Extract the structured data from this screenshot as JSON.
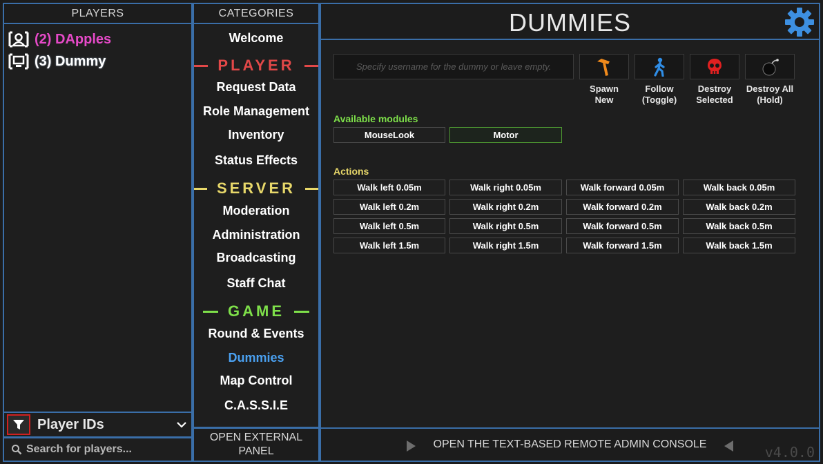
{
  "players": {
    "header": "PLAYERS",
    "items": [
      {
        "label": "(2) DApples",
        "color": "#e64ac8",
        "icon": "user-icon"
      },
      {
        "label": "(3) Dummy",
        "color": "#ffffff",
        "icon": "dummy-computer-icon"
      }
    ],
    "filter_label": "Player IDs",
    "search_placeholder": "Search for players..."
  },
  "categories": {
    "header": "CATEGORIES",
    "welcome": "Welcome",
    "sections": [
      {
        "title": "PLAYER",
        "color": "#e24848",
        "items": [
          "Request Data",
          "Role Management",
          "Inventory",
          "Status Effects"
        ]
      },
      {
        "title": "SERVER",
        "color": "#e8d86a",
        "items": [
          "Moderation",
          "Administration",
          "Broadcasting",
          "Staff Chat"
        ]
      },
      {
        "title": "GAME",
        "color": "#7ee04a",
        "items": [
          "Round & Events",
          "Dummies",
          "Map Control",
          "C.A.S.S.I.E"
        ]
      }
    ],
    "active_item": "Dummies",
    "active_color": "#4aa0f0",
    "external_panel": [
      "OPEN EXTERNAL",
      "PANEL"
    ]
  },
  "main": {
    "title": "DUMMIES",
    "username_placeholder": "Specify username for the dummy or leave empty.",
    "tools": [
      {
        "label": [
          "Spawn",
          "New"
        ],
        "icon": "hammer-icon"
      },
      {
        "label": [
          "Follow",
          "(Toggle)"
        ],
        "icon": "walking-person-icon"
      },
      {
        "label": [
          "Destroy",
          "Selected"
        ],
        "icon": "skull-icon"
      },
      {
        "label": [
          "Destroy All",
          "(Hold)"
        ],
        "icon": "bomb-icon"
      }
    ],
    "modules_label": "Available modules",
    "modules": [
      {
        "label": "MouseLook",
        "active": false
      },
      {
        "label": "Motor",
        "active": true
      }
    ],
    "actions_label": "Actions",
    "actions": [
      [
        "Walk left 0.05m",
        "Walk right 0.05m",
        "Walk forward 0.05m",
        "Walk back 0.05m"
      ],
      [
        "Walk left 0.2m",
        "Walk right 0.2m",
        "Walk forward 0.2m",
        "Walk back 0.2m"
      ],
      [
        "Walk left 0.5m",
        "Walk right 0.5m",
        "Walk forward 0.5m",
        "Walk back 0.5m"
      ],
      [
        "Walk left 1.5m",
        "Walk right 1.5m",
        "Walk forward 1.5m",
        "Walk back 1.5m"
      ]
    ]
  },
  "console": {
    "label": "OPEN THE TEXT-BASED REMOTE ADMIN CONSOLE",
    "version": "v4.0.0"
  },
  "colors": {
    "border": "#3a6ea8",
    "modules_label": "#7ee04a",
    "actions_label": "#e8d86a",
    "gear": "#3d8fe0"
  }
}
